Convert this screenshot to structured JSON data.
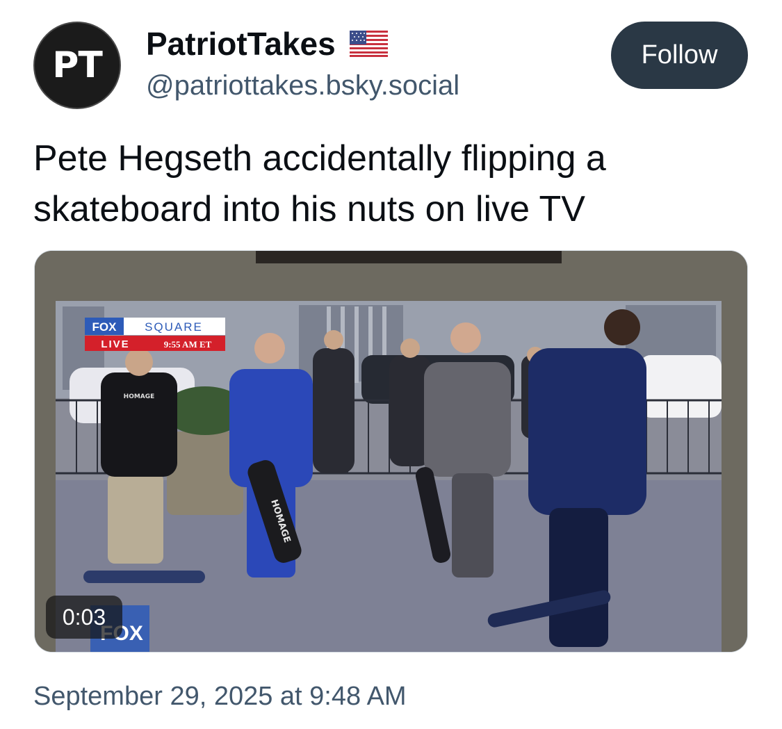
{
  "author": {
    "avatar_initials": "PT",
    "display_name": "PatriotTakes",
    "handle": "@patriottakes.bsky.social",
    "flag_icon": "us-flag-icon"
  },
  "follow_button": {
    "label": "Follow"
  },
  "post": {
    "text": "Pete Hegseth accidentally flipping a skateboard into his nuts on live TV",
    "timestamp": "September 29, 2025 at 9:48 AM"
  },
  "video": {
    "duration": "0:03",
    "overlay": {
      "fox": "FOX",
      "square": "SQUARE",
      "live": "LIVE",
      "time": "9:55 AM ET",
      "corner_logo": "FOX",
      "board_text": "HOMAGE",
      "shirt_text": "HOMAGE"
    }
  },
  "colors": {
    "follow_bg": "#2a3845",
    "secondary_text": "#42576c",
    "fox_blue": "#2d5bb8",
    "fox_red": "#d4202a"
  }
}
